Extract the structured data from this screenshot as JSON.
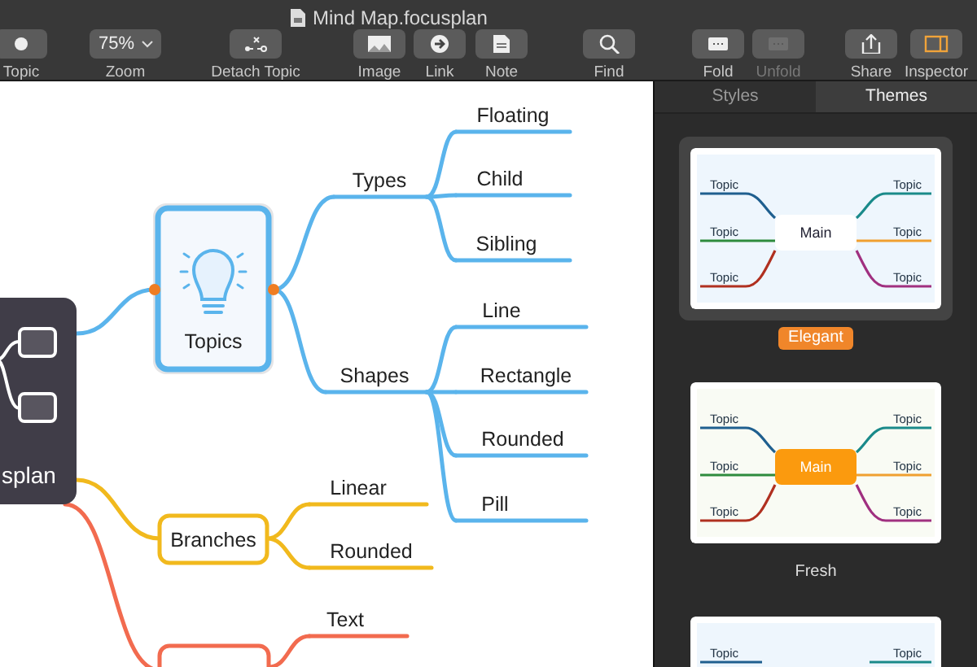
{
  "window": {
    "title": "Mind Map.focusplan"
  },
  "toolbar": [
    {
      "kind": "topic",
      "label": "Topic",
      "disabled": false,
      "active": false
    },
    {
      "kind": "zoom",
      "label": "Zoom",
      "value": "75%",
      "disabled": false,
      "active": false
    },
    {
      "kind": "detach",
      "label": "Detach Topic",
      "disabled": false,
      "active": false
    },
    {
      "kind": "image",
      "label": "Image",
      "disabled": false,
      "active": false
    },
    {
      "kind": "link",
      "label": "Link",
      "disabled": false,
      "active": false
    },
    {
      "kind": "note",
      "label": "Note",
      "disabled": false,
      "active": false
    },
    {
      "kind": "find",
      "label": "Find",
      "disabled": false,
      "active": false
    },
    {
      "kind": "fold",
      "label": "Fold",
      "disabled": false,
      "active": false
    },
    {
      "kind": "fold",
      "label": "Unfold",
      "disabled": true,
      "active": false
    },
    {
      "kind": "share",
      "label": "Share",
      "disabled": false,
      "active": false
    },
    {
      "kind": "inspector",
      "label": "Inspector",
      "disabled": false,
      "active": true
    }
  ],
  "map": {
    "root": {
      "label": "splan"
    },
    "branches": [
      {
        "label": "Topics",
        "kind": "card",
        "selected": true,
        "color": "#5ab4ec",
        "children": [
          {
            "label": "Types",
            "children": [
              {
                "label": "Floating"
              },
              {
                "label": "Child"
              },
              {
                "label": "Sibling"
              }
            ]
          },
          {
            "label": "Shapes",
            "children": [
              {
                "label": "Line"
              },
              {
                "label": "Rectangle"
              },
              {
                "label": "Rounded"
              },
              {
                "label": "Pill"
              }
            ]
          }
        ]
      },
      {
        "label": "Branches",
        "kind": "box",
        "selected": false,
        "color": "#f1b91d",
        "children": [
          {
            "label": "Linear"
          },
          {
            "label": "Rounded"
          }
        ]
      },
      {
        "kind": "box",
        "selected": false,
        "color": "#f26b4f",
        "children": [
          {
            "label": "Text"
          }
        ]
      }
    ]
  },
  "inspector": {
    "tabs": [
      {
        "label": "Styles",
        "selected": false
      },
      {
        "label": "Themes",
        "selected": true
      }
    ],
    "themes": [
      {
        "name": "Elegant",
        "selected": true,
        "main": "Main",
        "kind": "plain",
        "topics": [
          "Topic",
          "Topic",
          "Topic",
          "Topic",
          "Topic",
          "Topic"
        ]
      },
      {
        "name": "Fresh",
        "selected": false,
        "main": "Main",
        "kind": "filled",
        "topics": [
          "Topic",
          "Topic",
          "Topic",
          "Topic",
          "Topic",
          "Topic"
        ]
      },
      {
        "selected": false,
        "kind": "plain",
        "topics": [
          "Topic",
          "Topic"
        ]
      }
    ]
  }
}
